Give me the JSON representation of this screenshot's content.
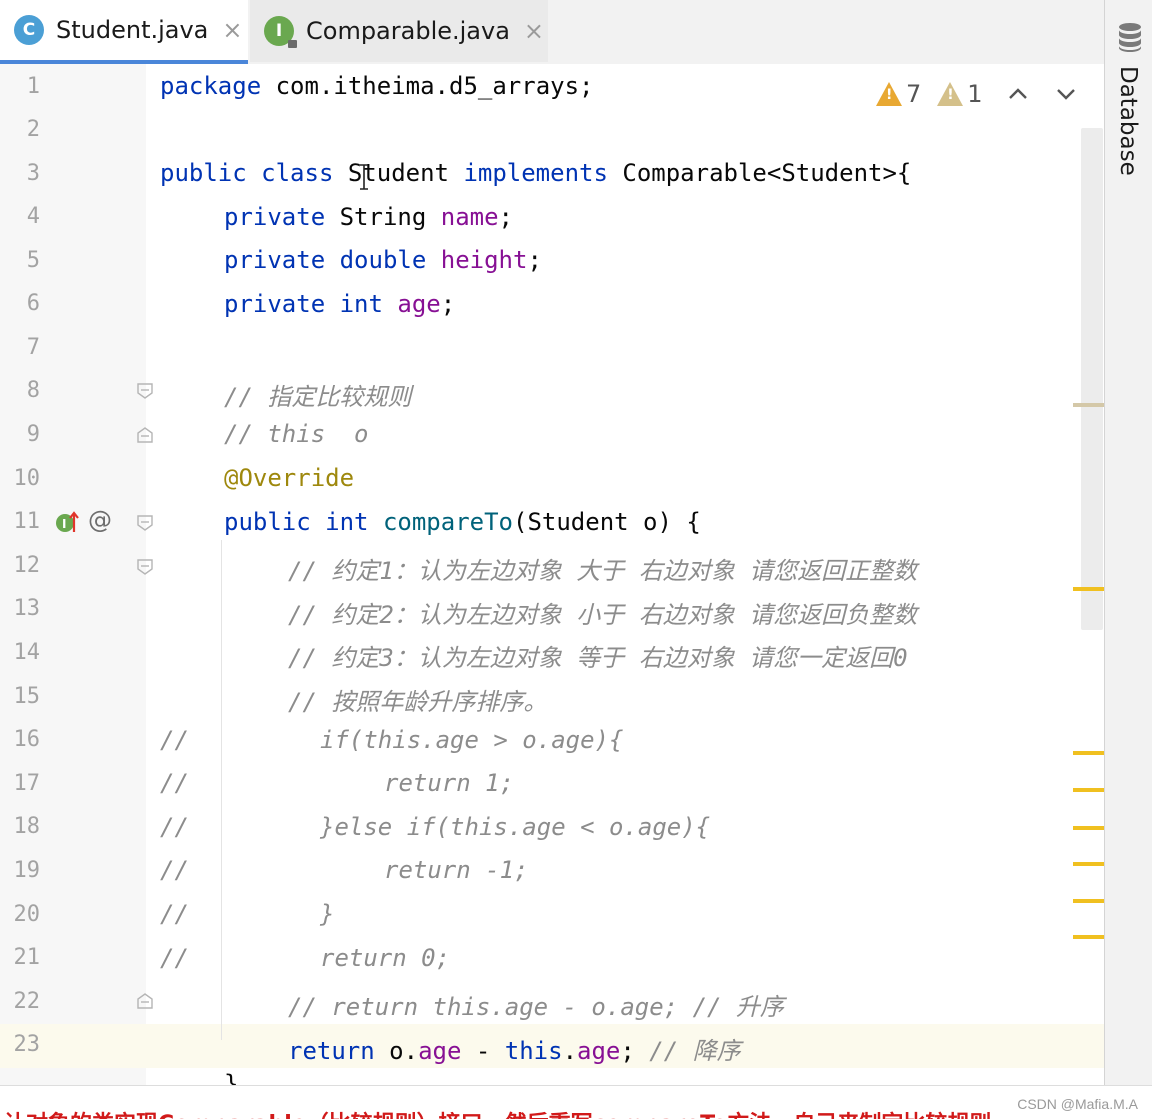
{
  "tabs": [
    {
      "icon": "C",
      "label": "Student.java",
      "close": "×",
      "active": true
    },
    {
      "icon": "I",
      "label": "Comparable.java",
      "close": "×",
      "active": false
    }
  ],
  "toolstrip": {
    "label": "Database",
    "icon": "database-icon"
  },
  "inspection": {
    "warnings": "7",
    "weak_warnings": "1",
    "up": "⌃",
    "down": "⌄"
  },
  "gutter": {
    "override_marker": "@"
  },
  "lines": [
    {
      "n": "1"
    },
    {
      "n": "2"
    },
    {
      "n": "3"
    },
    {
      "n": "4"
    },
    {
      "n": "5"
    },
    {
      "n": "6"
    },
    {
      "n": "7"
    },
    {
      "n": "8"
    },
    {
      "n": "9"
    },
    {
      "n": "10"
    },
    {
      "n": "11"
    },
    {
      "n": "12"
    },
    {
      "n": "13"
    },
    {
      "n": "14"
    },
    {
      "n": "15"
    },
    {
      "n": "16"
    },
    {
      "n": "17"
    },
    {
      "n": "18"
    },
    {
      "n": "19"
    },
    {
      "n": "20"
    },
    {
      "n": "21"
    },
    {
      "n": "22"
    },
    {
      "n": "23"
    }
  ],
  "code": {
    "l1_kw": "package",
    "l1_rest": " com.itheima.d5_arrays;",
    "l3_kw1": "public class",
    "l3_name": " Student ",
    "l3_kw2": "implements",
    "l3_rest": " Comparable<Student>{",
    "l4_kw": "private",
    "l4_type": " String ",
    "l4_field": "name",
    "l4_end": ";",
    "l5_kw": "private double",
    "l5_field": " height",
    "l5_end": ";",
    "l6_kw": "private int",
    "l6_field": " age",
    "l6_end": ";",
    "l8": "// 指定比较规则",
    "l9": "// this  o",
    "l10": "@Override",
    "l11_kw": "public int",
    "l11_fn": " compareTo",
    "l11_rest": "(Student o) {",
    "l12": "// 约定1：认为左边对象 大于 右边对象 请您返回正整数",
    "l13": "// 约定2：认为左边对象 小于 右边对象 请您返回负整数",
    "l14": "// 约定3：认为左边对象 等于 右边对象 请您一定返回0",
    "l15": "// 按照年龄升序排序。",
    "l16_mark": "//",
    "l16": "if(this.age > o.age){",
    "l17_mark": "//",
    "l17": "return 1;",
    "l18_mark": "//",
    "l18": "}else if(this.age < o.age){",
    "l19_mark": "//",
    "l19": "return -1;",
    "l20_mark": "//",
    "l20": "}",
    "l21_mark": "//",
    "l21": "return 0;",
    "l22": "// return this.age - o.age; // 升序",
    "l23_kw": "return",
    "l23_o": " o.",
    "l23_f1": "age",
    "l23_mid": " - ",
    "l23_this": "this",
    "l23_dot": ".",
    "l23_f2": "age",
    "l23_semi": "; ",
    "l23_cmt": "// 降序",
    "l24_partial": "}"
  },
  "caption": {
    "text": "让对象的类实现Comparable（比较规则）接口，然后重写compareTo方法，自己来制定比较规则",
    "watermark": "CSDN @Mafia.M.A"
  },
  "colors": {
    "keyword": "#0033b3",
    "field": "#871094",
    "annotation": "#9e880d",
    "comment": "#8c8c8c",
    "method": "#00627a",
    "warning": "#e8a832",
    "tab_accent": "#4a86d9"
  }
}
